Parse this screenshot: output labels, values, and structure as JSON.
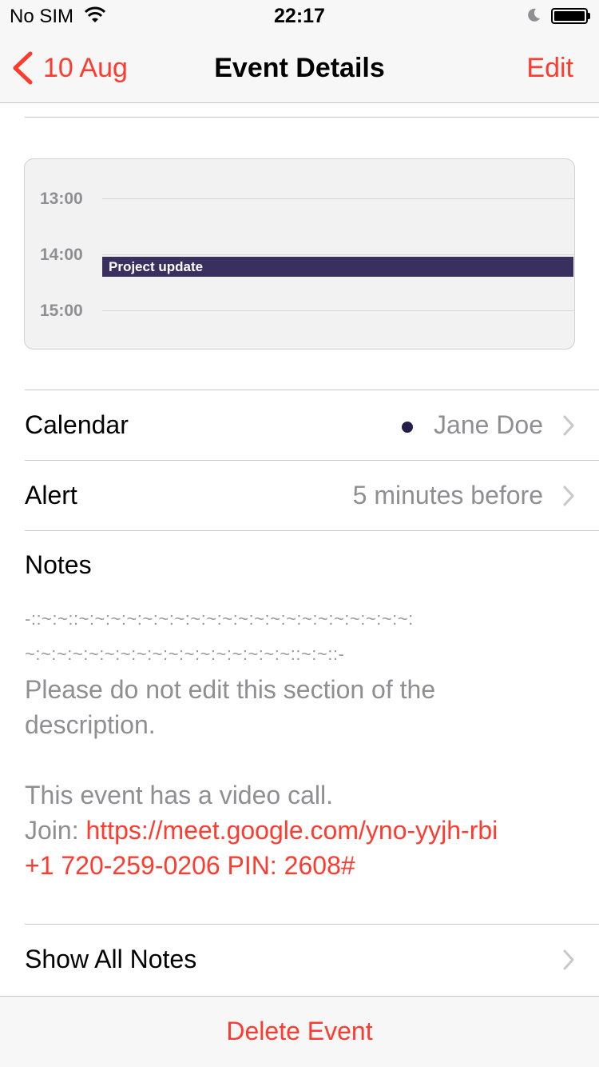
{
  "status_bar": {
    "carrier": "No SIM",
    "time": "22:17",
    "icons": [
      "wifi-icon",
      "moon-icon",
      "battery-icon"
    ]
  },
  "nav": {
    "back_label": "10 Aug",
    "title": "Event Details",
    "edit_label": "Edit"
  },
  "day_preview": {
    "hours": [
      "13:00",
      "14:00",
      "15:00"
    ],
    "event_title": "Project update",
    "event_color": "#3a3060"
  },
  "rows": {
    "calendar": {
      "label": "Calendar",
      "value": "Jane Doe",
      "dot_color": "#25204b"
    },
    "alert": {
      "label": "Alert",
      "value": "5 minutes before"
    }
  },
  "notes": {
    "title": "Notes",
    "deco_line_1": "-::~:~::~:~:~:~:~:~:~:~:~:~:~:~:~:~:~:~:~:~:~:~:~:",
    "deco_line_2": "~:~:~:~:~:~:~:~:~:~:~:~:~:~:~:~:~::~:~::-",
    "warning": "Please do not edit this section of the description.",
    "video_line": "This event has a video call.",
    "join_prefix": "Join: ",
    "join_link": "https://meet.google.com/yno-yyjh-rbi",
    "phone_link": "+1 720-259-0206 PIN: 2608#"
  },
  "show_all_notes": "Show All Notes",
  "delete_label": "Delete Event",
  "colors": {
    "accent": "#ff3b30",
    "secondary_text": "#8e8e93"
  }
}
